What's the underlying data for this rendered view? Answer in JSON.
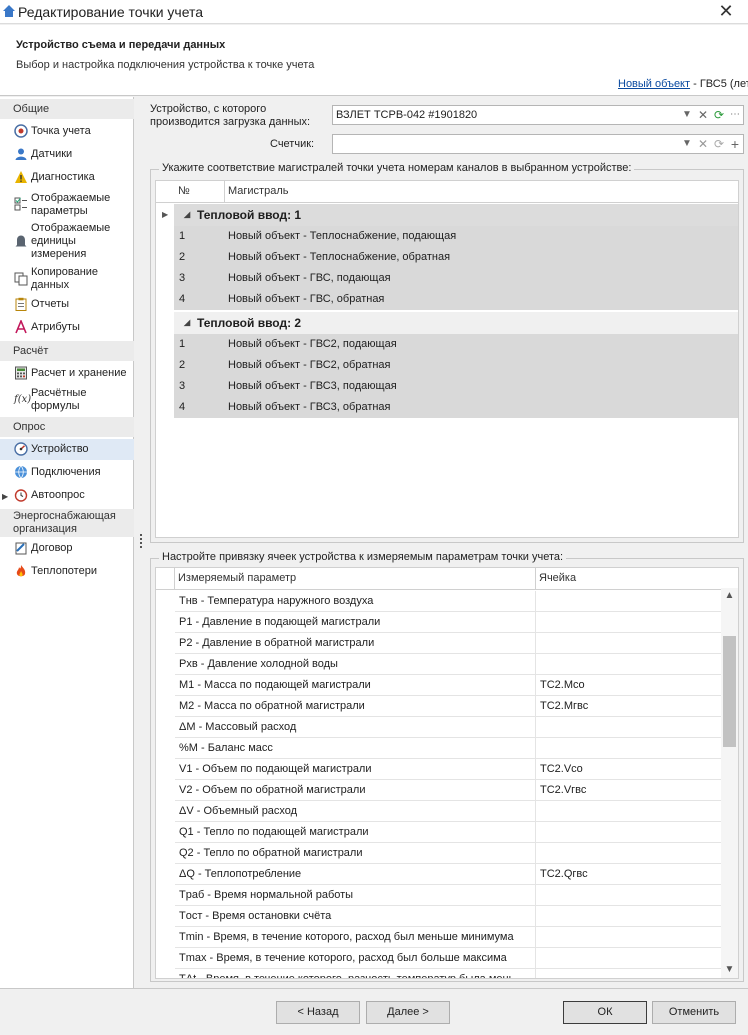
{
  "window": {
    "title": "Редактирование точки учета",
    "close_label": "✕"
  },
  "header": {
    "title": "Устройство съема и передачи данных",
    "subtitle": "Выбор и настройка подключения устройства к точке учета",
    "breadcrumb_link": "Новый объект",
    "breadcrumb_rest": " - ГВС5 (лет"
  },
  "sidebar": {
    "groups": [
      {
        "label": "Общие"
      },
      {
        "label": "Расчёт"
      },
      {
        "label": "Опрос"
      },
      {
        "label": "Энергоснабжающая организация"
      }
    ],
    "items": [
      {
        "label": "Точка учета",
        "icon": "target-icon"
      },
      {
        "label": "Датчики",
        "icon": "person-icon"
      },
      {
        "label": "Диагностика",
        "icon": "warning-icon"
      },
      {
        "label": "Отображаемые параметры",
        "icon": "checklist-icon"
      },
      {
        "label": "Отображаемые единицы измерения",
        "icon": "bell-icon"
      },
      {
        "label": "Копирование данных",
        "icon": "copy-icon"
      },
      {
        "label": "Отчеты",
        "icon": "clipboard-icon"
      },
      {
        "label": "Атрибуты",
        "icon": "letter-a-icon"
      },
      {
        "label": "Расчет и хранение",
        "icon": "calculator-icon"
      },
      {
        "label": "Расчётные формулы",
        "icon": "formula-icon"
      },
      {
        "label": "Устройство",
        "icon": "device-icon"
      },
      {
        "label": "Подключения",
        "icon": "globe-icon"
      },
      {
        "label": "Автоопрос",
        "icon": "clock-icon"
      },
      {
        "label": "Договор",
        "icon": "contract-icon"
      },
      {
        "label": "Теплопотери",
        "icon": "flame-icon"
      }
    ]
  },
  "device": {
    "label": "Устройство, с которого производится загрузка данных:",
    "value": "ВЗЛЕТ ТСРВ-042 #1901820",
    "counter_label": "Счетчик:",
    "counter_value": ""
  },
  "mapping": {
    "legend": "Укажите соответствие магистралей точки учета номерам каналов в выбранном устройстве:",
    "col_no": "№",
    "col_main": "Магистраль",
    "groups": [
      {
        "title": "Тепловой ввод: 1",
        "rows": [
          {
            "no": "1",
            "name": "Новый объект - Теплоснабжение, подающая"
          },
          {
            "no": "2",
            "name": "Новый объект - Теплоснабжение, обратная"
          },
          {
            "no": "3",
            "name": "Новый объект - ГВС, подающая"
          },
          {
            "no": "4",
            "name": "Новый объект - ГВС, обратная"
          }
        ]
      },
      {
        "title": "Тепловой ввод: 2",
        "rows": [
          {
            "no": "1",
            "name": "Новый объект - ГВС2, подающая"
          },
          {
            "no": "2",
            "name": "Новый объект - ГВС2, обратная"
          },
          {
            "no": "3",
            "name": "Новый объект - ГВС3, подающая"
          },
          {
            "no": "4",
            "name": "Новый объект - ГВС3, обратная"
          }
        ]
      }
    ]
  },
  "params": {
    "legend": "Настройте привязку ячеек устройства к измеряемым параметрам точки учета:",
    "col_param": "Измеряемый параметр",
    "col_cell": "Ячейка",
    "rows": [
      {
        "param": "Tнв - Температура наружного воздуха",
        "cell": ""
      },
      {
        "param": "P1 - Давление в подающей магистрали",
        "cell": ""
      },
      {
        "param": "P2 - Давление в обратной магистрали",
        "cell": ""
      },
      {
        "param": "Pхв - Давление холодной воды",
        "cell": ""
      },
      {
        "param": "M1 - Масса по подающей магистрали",
        "cell": "TC2.Mco"
      },
      {
        "param": "M2 - Масса по обратной магистрали",
        "cell": "TC2.Mгвс"
      },
      {
        "param": "ΔM - Массовый расход",
        "cell": ""
      },
      {
        "param": "%M - Баланс масс",
        "cell": ""
      },
      {
        "param": "V1 - Объем по подающей магистрали",
        "cell": "TC2.Vco"
      },
      {
        "param": "V2 - Объем по обратной магистрали",
        "cell": "TC2.Vгвс"
      },
      {
        "param": "ΔV - Объемный расход",
        "cell": ""
      },
      {
        "param": "Q1 - Тепло по подающей магистрали",
        "cell": ""
      },
      {
        "param": "Q2 - Тепло по обратной магистрали",
        "cell": ""
      },
      {
        "param": "ΔQ - Теплопотребление",
        "cell": "TC2.Qгвс"
      },
      {
        "param": "Tраб - Время нормальной работы",
        "cell": ""
      },
      {
        "param": "Tост - Время остановки счёта",
        "cell": ""
      },
      {
        "param": "Tmin - Время, в течение которого, расход был меньше минимума",
        "cell": ""
      },
      {
        "param": "Tmax - Время, в течение которого, расход был больше максима",
        "cell": ""
      },
      {
        "param": "TΔt - Время, в течение которого, разность температур была мень",
        "cell": ""
      }
    ]
  },
  "footer": {
    "back": "< Назад",
    "next": "Далее >",
    "ok": "ОК",
    "cancel": "Отменить"
  }
}
